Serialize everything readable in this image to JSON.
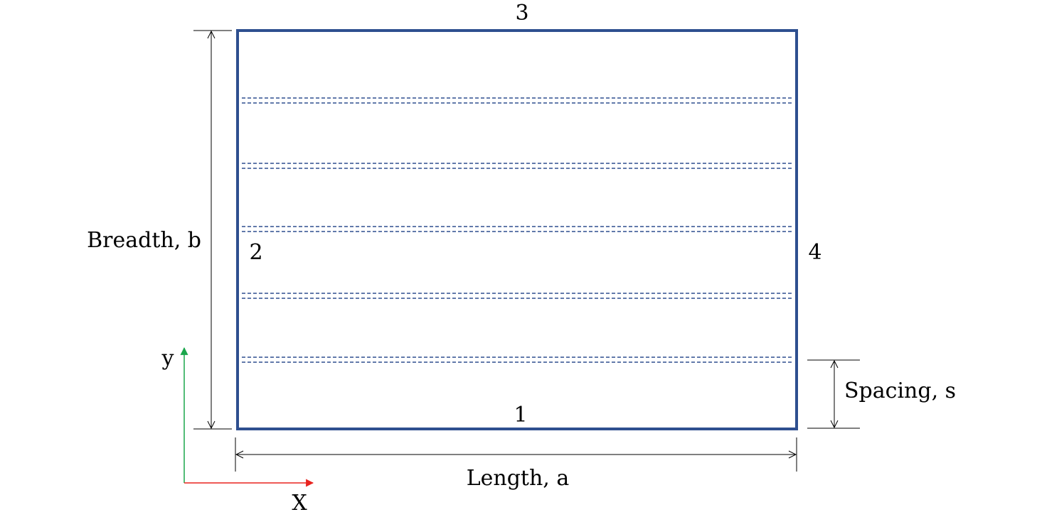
{
  "edges": {
    "bottom": "1",
    "left": "2",
    "top": "3",
    "right": "4"
  },
  "dimensions": {
    "breadth": "Breadth, b",
    "length": "Length, a",
    "spacing": "Spacing, s"
  },
  "axes": {
    "x": "X",
    "y": "y"
  },
  "stiffener_count": 5,
  "colors": {
    "plate": "#2e4f8f",
    "stiffener": "#2e4f8f",
    "y_axis": "#1aa64b",
    "x_axis": "#e8231f",
    "dimension": "#000000"
  }
}
